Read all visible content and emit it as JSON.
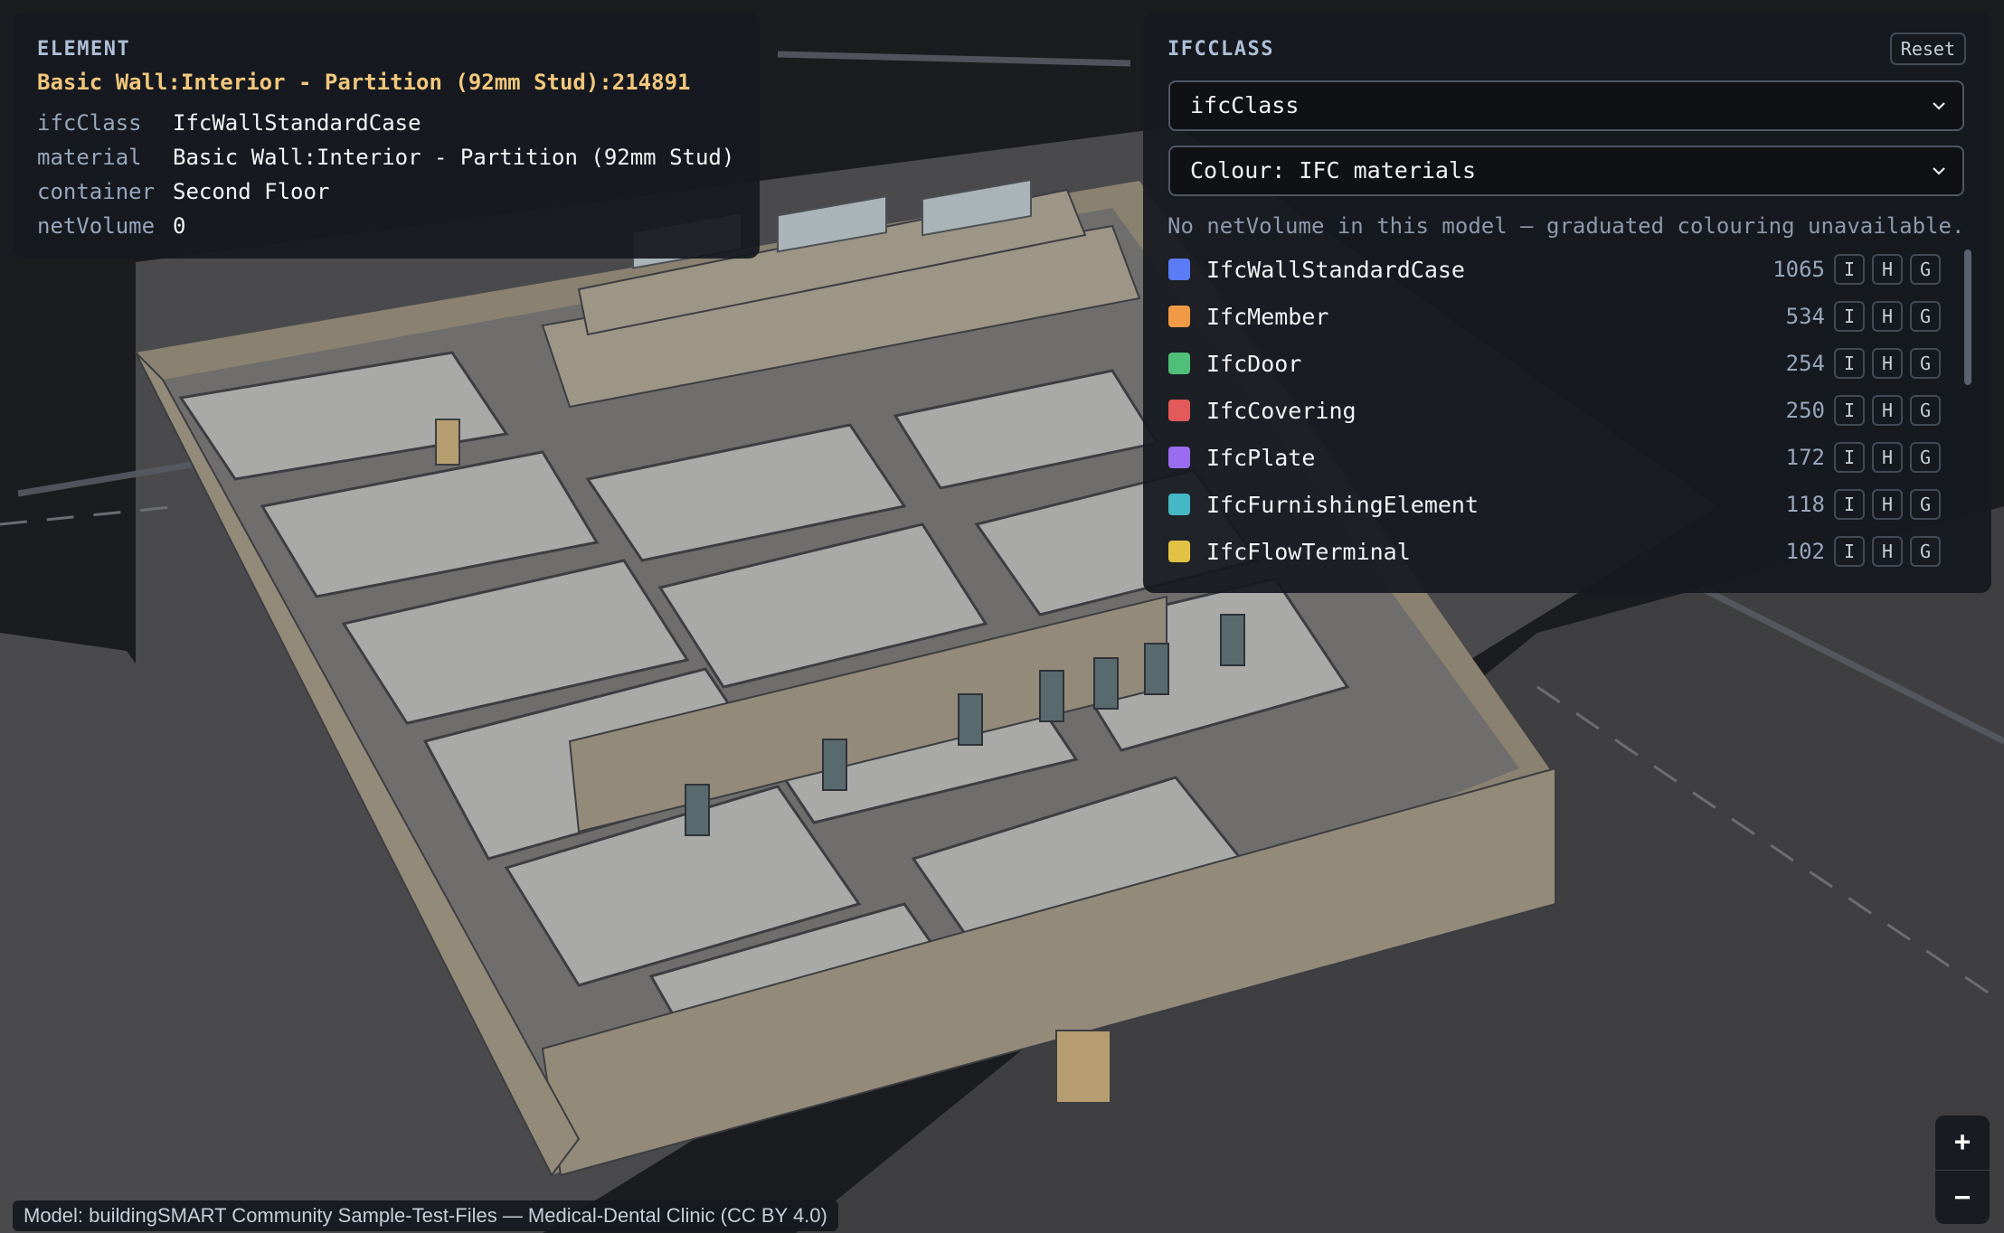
{
  "element": {
    "heading": "ELEMENT",
    "title": "Basic Wall:Interior - Partition (92mm Stud):214891",
    "properties": [
      {
        "key": "ifcClass",
        "value": "IfcWallStandardCase"
      },
      {
        "key": "material",
        "value": "Basic Wall:Interior - Partition (92mm Stud)"
      },
      {
        "key": "container",
        "value": "Second Floor"
      },
      {
        "key": "netVolume",
        "value": "0"
      }
    ]
  },
  "class_panel": {
    "heading": "IFCCLASS",
    "reset_label": "Reset",
    "group_select": "ifcClass",
    "colour_select": "Colour: IFC materials",
    "notice": "No netVolume in this model — graduated colouring unavailable.",
    "toggle_labels": {
      "isolate": "I",
      "hide": "H",
      "ghost": "G"
    },
    "items": [
      {
        "name": "IfcWallStandardCase",
        "count": "1065",
        "color": "#5b7cf7"
      },
      {
        "name": "IfcMember",
        "count": "534",
        "color": "#f09a45"
      },
      {
        "name": "IfcDoor",
        "count": "254",
        "color": "#4fbf7a"
      },
      {
        "name": "IfcCovering",
        "count": "250",
        "color": "#e25a5a"
      },
      {
        "name": "IfcPlate",
        "count": "172",
        "color": "#9b6cf0"
      },
      {
        "name": "IfcFurnishingElement",
        "count": "118",
        "color": "#46b7c6"
      },
      {
        "name": "IfcFlowTerminal",
        "count": "102",
        "color": "#e2c244"
      }
    ]
  },
  "zoom": {
    "in_label": "+",
    "out_label": "−"
  },
  "attribution": "Model: buildingSMART Community Sample-Test-Files — Medical-Dental Clinic (CC BY 4.0)"
}
